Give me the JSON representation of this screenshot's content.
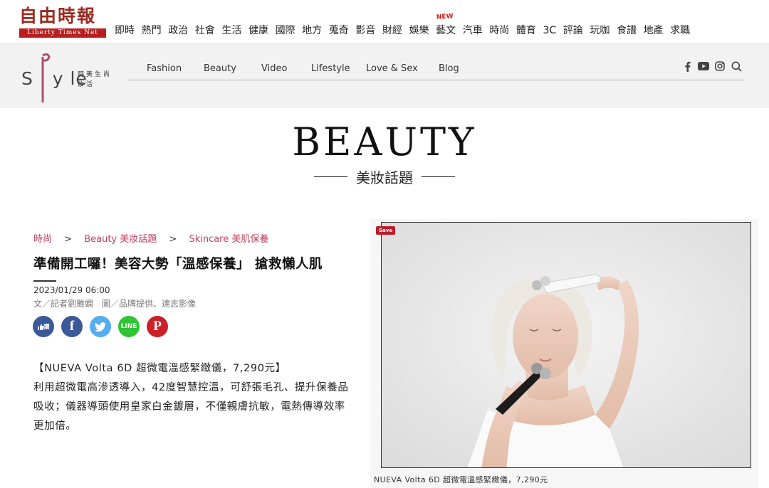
{
  "ltn": {
    "logo_text": "自由時報",
    "logo_sub": "Liberty Times Net",
    "nav": [
      "即時",
      "熱門",
      "政治",
      "社會",
      "生活",
      "健康",
      "國際",
      "地方",
      "蒐奇",
      "影音",
      "財經",
      "娛樂",
      "藝文",
      "汽車",
      "時尚",
      "體育",
      "3C",
      "評論",
      "玩咖",
      "食譜",
      "地產",
      "求職"
    ],
    "new_badge": "NEW"
  },
  "style": {
    "logo_word": "Style",
    "logo_zh": "時美生尚妝活",
    "nav": [
      "Fashion",
      "Beauty",
      "Video",
      "Lifestyle",
      "Love & Sex",
      "Blog"
    ],
    "social_icons": [
      "facebook-icon",
      "youtube-icon",
      "instagram-icon",
      "search-icon"
    ]
  },
  "section": {
    "title": "BEAUTY",
    "subtitle": "美妝話題"
  },
  "breadcrumb": [
    "時尚",
    "Beauty 美妝話題",
    "Skincare 美肌保養"
  ],
  "breadcrumb_sep": ">",
  "article": {
    "headline": "準備開工囉！美容大勢「溫感保養」 搶救懶人肌",
    "date": "2023/01/29 06:00",
    "byline": "文／記者劉雅嫻　圖／品牌提供、達志影像",
    "share_buttons": [
      {
        "name": "like-share-icon",
        "label": "讚",
        "color": "#3b5998"
      },
      {
        "name": "facebook-share-icon",
        "label": "f",
        "color": "#3b5998"
      },
      {
        "name": "twitter-share-icon",
        "label": "t",
        "color": "#55acee"
      },
      {
        "name": "line-share-icon",
        "label": "LINE",
        "color": "#2fc335"
      },
      {
        "name": "pinterest-share-icon",
        "label": "P",
        "color": "#cb2027"
      }
    ],
    "body": [
      "【NUEVA Volta 6D 超微電溫感緊緻儀，7,290元】",
      "利用超微電高滲透導入，42度智慧控溫，可舒張毛孔、提升保養品吸收；儀器導頭使用皇家白金鍍層，不僅親膚抗敏，電熱傳導效率更加倍。"
    ]
  },
  "photo": {
    "save_label": "Save",
    "caption": "NUEVA Volta 6D 超微電溫感緊緻儀，7,290元"
  }
}
